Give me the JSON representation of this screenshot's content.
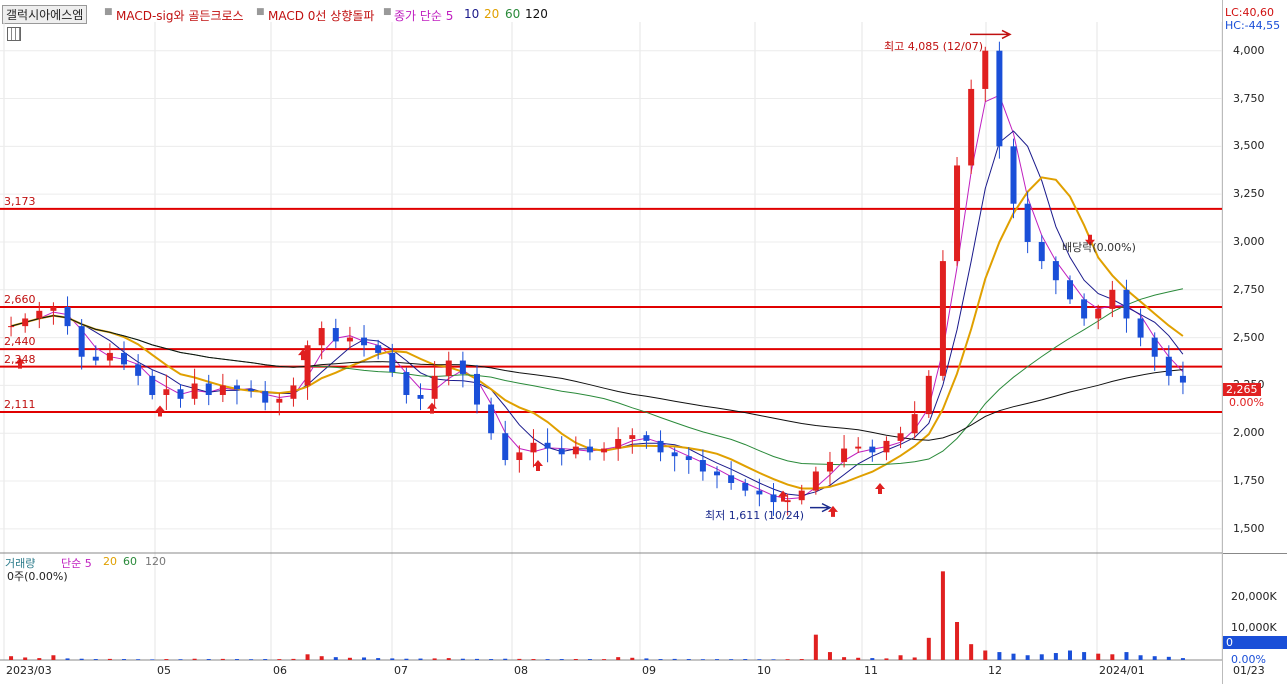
{
  "toolbar": {
    "stock_name": "갤럭시아에스엠",
    "indicator1": "MACD-sig와 골든크로스",
    "indicator2": "MACD 0선 상향돌파",
    "ma_label": "종가 단순 5",
    "ma_10": "10",
    "ma_20": "20",
    "ma_60": "60",
    "ma_120": "120"
  },
  "right_info": {
    "lc": "LC:40,60",
    "hc": "HC:-44,55"
  },
  "price_panel": {
    "current_price": "2,265",
    "current_pct": "0.00%",
    "high_note": "최고 4,085 (12/07)",
    "low_note": "최저 1,611 (10/24)",
    "event_note": "배당락(0.00%)",
    "hlines": [
      {
        "label": "3,173",
        "value": 3173
      },
      {
        "label": "2,660",
        "value": 2660
      },
      {
        "label": "2,440",
        "value": 2440
      },
      {
        "label": "2,348",
        "value": 2348
      },
      {
        "label": "2,111",
        "value": 2111
      }
    ],
    "yticks": [
      "4,000",
      "3,750",
      "3,500",
      "3,250",
      "3,000",
      "2,750",
      "2,500",
      "2,250",
      "2,000",
      "1,750",
      "1,500"
    ]
  },
  "volume_panel": {
    "label": "거래량",
    "ma_label": "단순 5",
    "ma_20": "20",
    "ma_60": "60",
    "ma_120": "120",
    "current": "0주(0.00%)",
    "yticks": [
      "20,000K",
      "10,000K",
      "0.00%"
    ],
    "current_box": "0"
  },
  "xaxis": [
    "2023/03",
    "05",
    "06",
    "07",
    "08",
    "09",
    "10",
    "11",
    "12",
    "2024/01",
    "01/23"
  ],
  "colors": {
    "up": "#e02020",
    "down": "#1a4fd8",
    "ma5": "#c020c0",
    "ma10": "#1a1a8c",
    "ma20": "#e0a000",
    "ma60": "#2a8a3a",
    "ma120": "#111111",
    "hline": "#e00000"
  },
  "chart_data": {
    "type": "candlestick",
    "title": "갤럭시아에스엠",
    "x_range": [
      "2023/03",
      "01/23"
    ],
    "ylim": [
      1400,
      4150
    ],
    "series": [
      {
        "name": "종가 단순 5",
        "values": []
      },
      {
        "name": "10",
        "values": []
      },
      {
        "name": "20",
        "values": []
      },
      {
        "name": "60",
        "values": []
      },
      {
        "name": "120",
        "values": []
      }
    ],
    "close_path": [
      2560,
      2600,
      2640,
      2660,
      2560,
      2400,
      2380,
      2420,
      2360,
      2300,
      2200,
      2230,
      2180,
      2260,
      2200,
      2250,
      2230,
      2220,
      2160,
      2180,
      2250,
      2460,
      2550,
      2480,
      2500,
      2460,
      2420,
      2320,
      2200,
      2180,
      2300,
      2380,
      2310,
      2150,
      2000,
      1860,
      1900,
      1950,
      1920,
      1890,
      1930,
      1900,
      1920,
      1970,
      1990,
      1960,
      1900,
      1880,
      1860,
      1800,
      1780,
      1740,
      1700,
      1680,
      1640,
      1650,
      1700,
      1800,
      1850,
      1920,
      1930,
      1900,
      1960,
      2000,
      2100,
      2300,
      2900,
      3400,
      3800,
      4000,
      3500,
      3200,
      3000,
      2900,
      2800,
      2700,
      2600,
      2650,
      2750,
      2600,
      2500,
      2400,
      2300,
      2265
    ],
    "volume_path": [
      1200,
      800,
      600,
      1500,
      500,
      400,
      300,
      350,
      300,
      250,
      200,
      300,
      250,
      400,
      300,
      350,
      300,
      250,
      300,
      280,
      350,
      1800,
      1200,
      900,
      700,
      800,
      600,
      500,
      400,
      450,
      500,
      600,
      400,
      350,
      300,
      400,
      350,
      300,
      280,
      300,
      320,
      300,
      280,
      900,
      700,
      500,
      300,
      350,
      300,
      250,
      280,
      260,
      300,
      240,
      220,
      260,
      300,
      8000,
      2500,
      900,
      700,
      600,
      500,
      1500,
      800,
      7000,
      28000,
      12000,
      5000,
      3000,
      2500,
      2000,
      1500,
      1800,
      2200,
      3000,
      2500,
      2000,
      1800,
      2500,
      1500,
      1200,
      1000,
      600
    ],
    "annotations": [
      "최고 4,085 (12/07)",
      "최저 1,611 (10/24)",
      "배당락(0.00%)"
    ]
  }
}
